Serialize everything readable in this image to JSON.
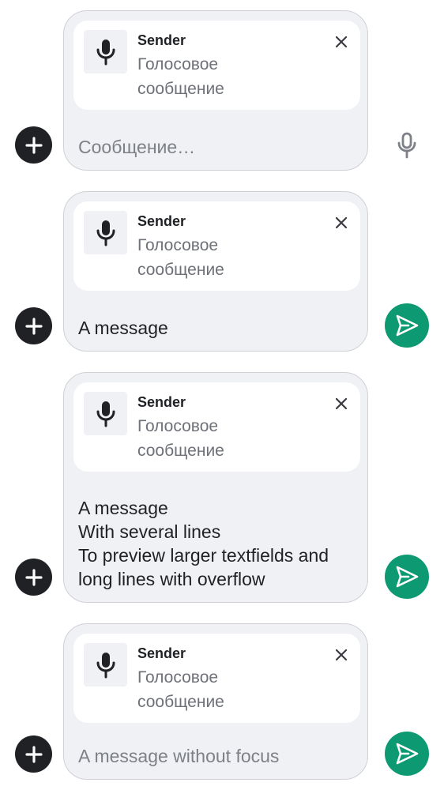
{
  "colors": {
    "composer_background": "#f0f1f4",
    "send_button": "#0d9a73",
    "plus_button": "#1f2125",
    "secondary_text": "#6e7178"
  },
  "composers": [
    {
      "reply": {
        "sender": "Sender",
        "text": "Голосовое сообщение",
        "icon": "mic-icon"
      },
      "message": "",
      "placeholder": "Сообщение…",
      "action": "microphone"
    },
    {
      "reply": {
        "sender": "Sender",
        "text": "Голосовое сообщение",
        "icon": "mic-icon"
      },
      "message": "A message",
      "action": "send"
    },
    {
      "reply": {
        "sender": "Sender",
        "text": "Голосовое сообщение",
        "icon": "mic-icon"
      },
      "message": "A message\nWith several lines\nTo preview larger textfields and long lines with overflow",
      "action": "send"
    },
    {
      "reply": {
        "sender": "Sender",
        "text": "Голосовое сообщение",
        "icon": "mic-icon"
      },
      "message": "",
      "placeholder": "A message without focus",
      "action": "send"
    }
  ]
}
